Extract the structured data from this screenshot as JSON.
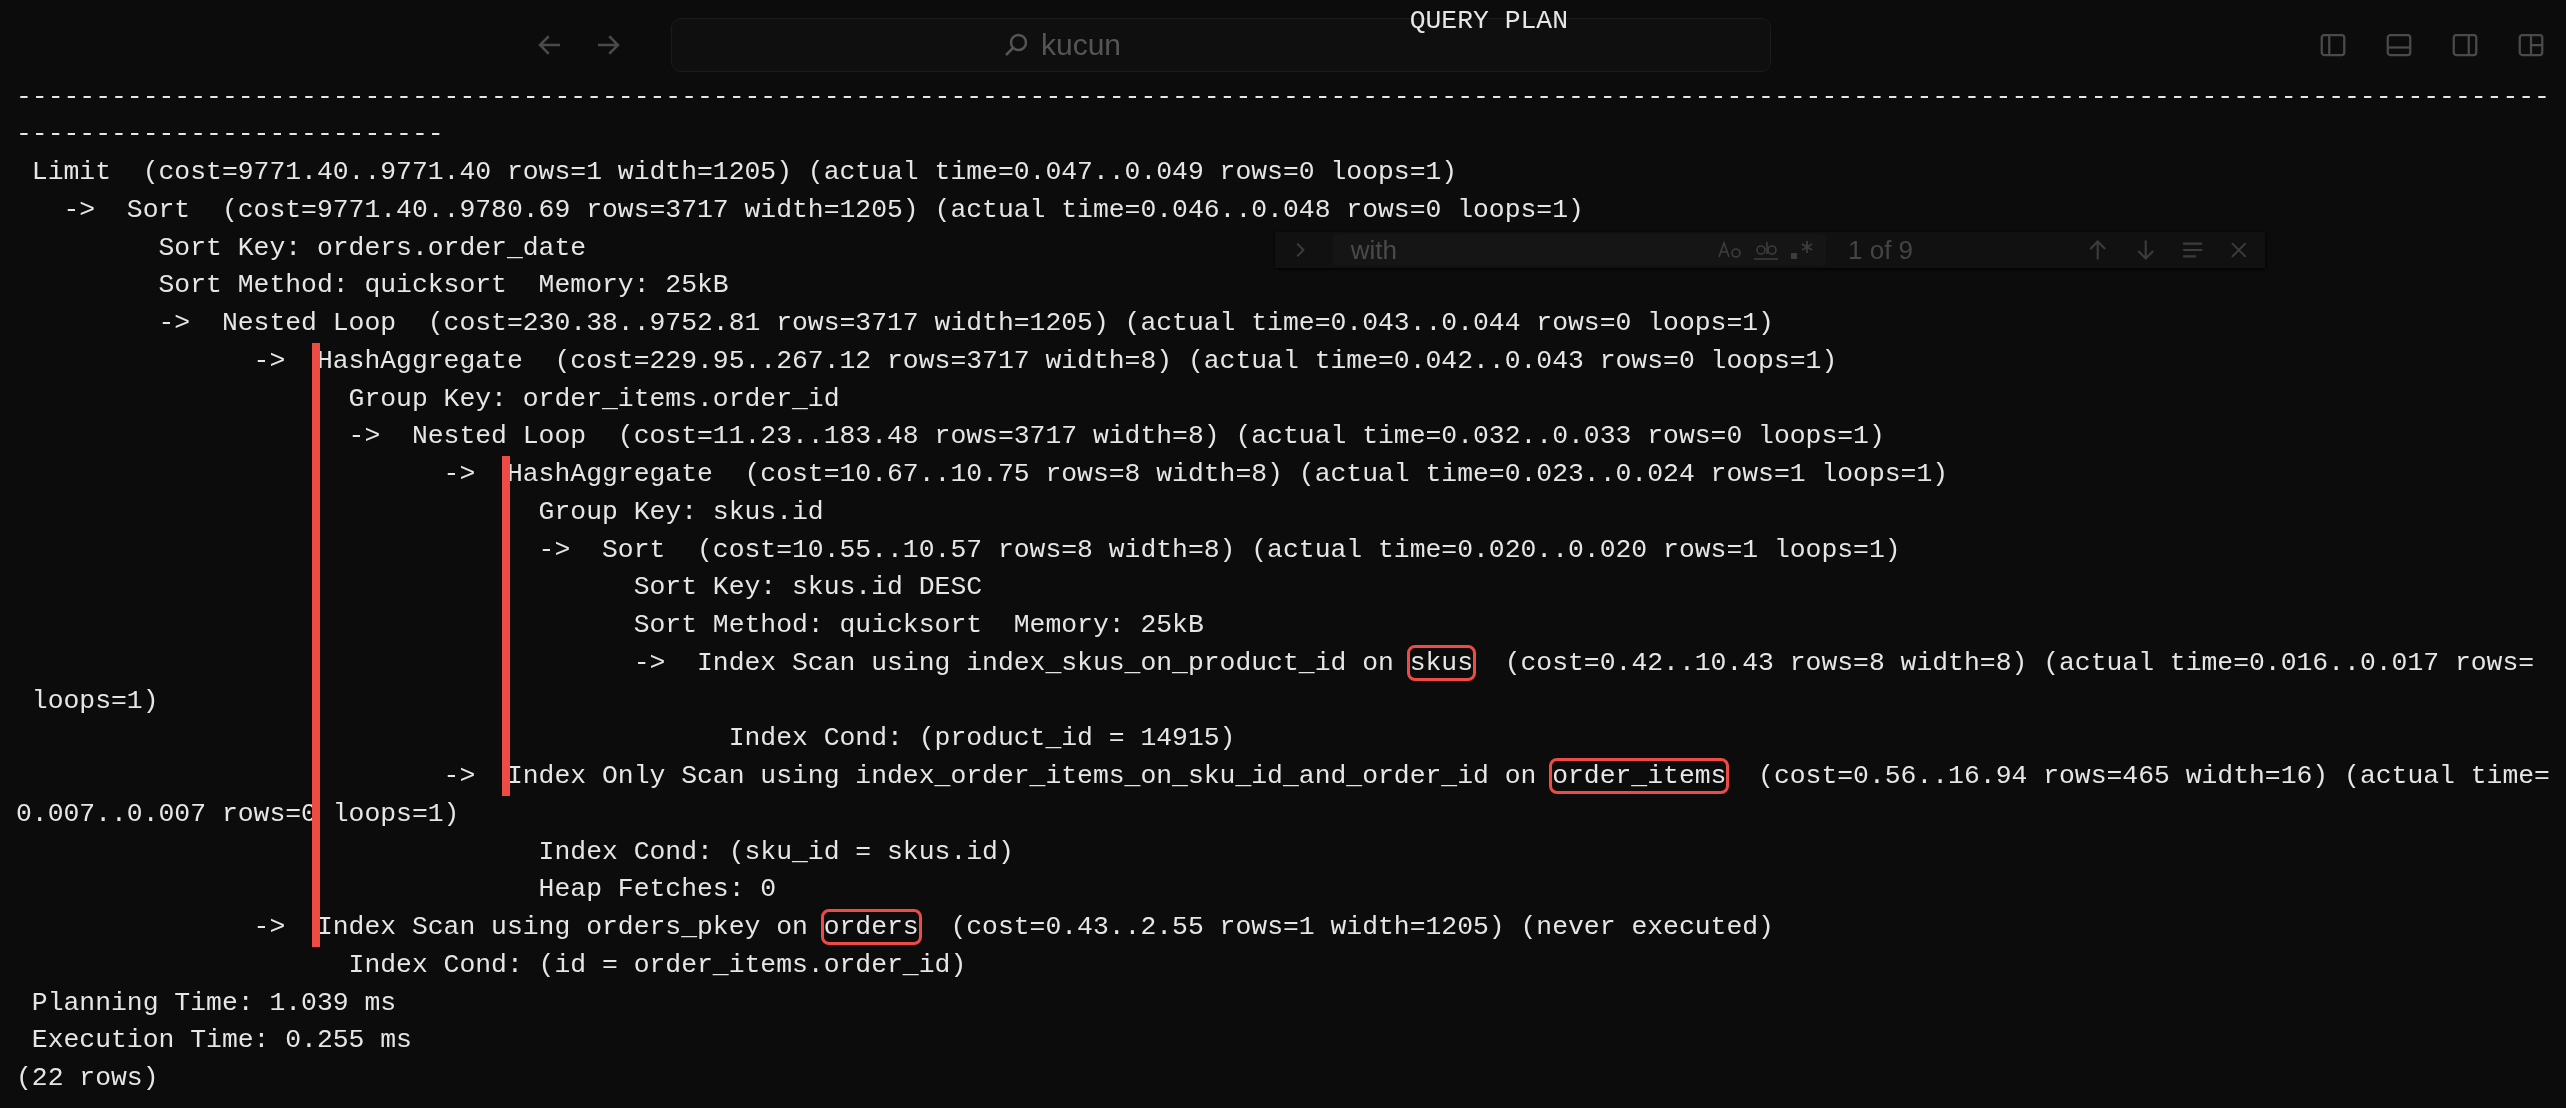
{
  "editor": {
    "title_bar": {
      "search": "kucun"
    },
    "find": {
      "value": "with",
      "result": "1 of 9"
    }
  },
  "terminal": {
    "lines": [
      {
        "text": "                                                                                        QUERY PLAN"
      },
      {
        "text": "----------------------------------------------------------------------------------------------------------------------------------------------------------------"
      },
      {
        "text": "---------------------------"
      },
      {
        "text": " Limit  (cost=9771.40..9771.40 rows=1 width=1205) (actual time=0.047..0.049 rows=0 loops=1)"
      },
      {
        "text": "   ->  Sort  (cost=9771.40..9780.69 rows=3717 width=1205) (actual time=0.046..0.048 rows=0 loops=1)"
      },
      {
        "text": "         Sort Key: orders.order_date"
      },
      {
        "text": "         Sort Method: quicksort  Memory: 25kB"
      },
      {
        "text": "         ->  Nested Loop  (cost=230.38..9752.81 rows=3717 width=1205) (actual time=0.043..0.044 rows=0 loops=1)"
      },
      {
        "text": "               ->  HashAggregate  (cost=229.95..267.12 rows=3717 width=8) (actual time=0.042..0.043 rows=0 loops=1)"
      },
      {
        "text": "                     Group Key: order_items.order_id"
      },
      {
        "text": "                     ->  Nested Loop  (cost=11.23..183.48 rows=3717 width=8) (actual time=0.032..0.033 rows=0 loops=1)"
      },
      {
        "text": "                           ->  HashAggregate  (cost=10.67..10.75 rows=8 width=8) (actual time=0.023..0.024 rows=1 loops=1)"
      },
      {
        "text": "                                 Group Key: skus.id"
      },
      {
        "text": "                                 ->  Sort  (cost=10.55..10.57 rows=8 width=8) (actual time=0.020..0.020 rows=1 loops=1)"
      },
      {
        "text": "                                       Sort Key: skus.id DESC"
      },
      {
        "text": "                                       Sort Method: quicksort  Memory: 25kB"
      },
      {
        "segments": [
          {
            "text": "                                       ->  Index Scan using index_skus_on_product_id on ",
            "boxed": false
          },
          {
            "text": "skus",
            "boxed": true
          },
          {
            "text": "  (cost=0.42..10.43 rows=8 width=8) (actual time=0.016..0.017 rows=",
            "boxed": false
          }
        ]
      },
      {
        "text": " loops=1)"
      },
      {
        "text": "                                             Index Cond: (product_id = 14915)"
      },
      {
        "segments": [
          {
            "text": "                           ->  Index Only Scan using index_order_items_on_sku_id_and_order_id on ",
            "boxed": false
          },
          {
            "text": "order_items",
            "boxed": true
          },
          {
            "text": "  (cost=0.56..16.94 rows=465 width=16) (actual time=",
            "boxed": false
          }
        ]
      },
      {
        "text": "0.007..0.007 rows=0 loops=1)"
      },
      {
        "text": "                                 Index Cond: (sku_id = skus.id)"
      },
      {
        "text": "                                 Heap Fetches: 0"
      },
      {
        "segments": [
          {
            "text": "               ->  Index Scan using orders_pkey on ",
            "boxed": false
          },
          {
            "text": "orders",
            "boxed": true
          },
          {
            "text": "  (cost=0.43..2.55 rows=1 width=1205) (never executed)",
            "boxed": false
          }
        ]
      },
      {
        "text": "                     Index Cond: (id = order_items.order_id)"
      },
      {
        "text": " Planning Time: 1.039 ms"
      },
      {
        "text": " Execution Time: 0.255 ms"
      },
      {
        "text": "(22 rows)"
      }
    ]
  }
}
